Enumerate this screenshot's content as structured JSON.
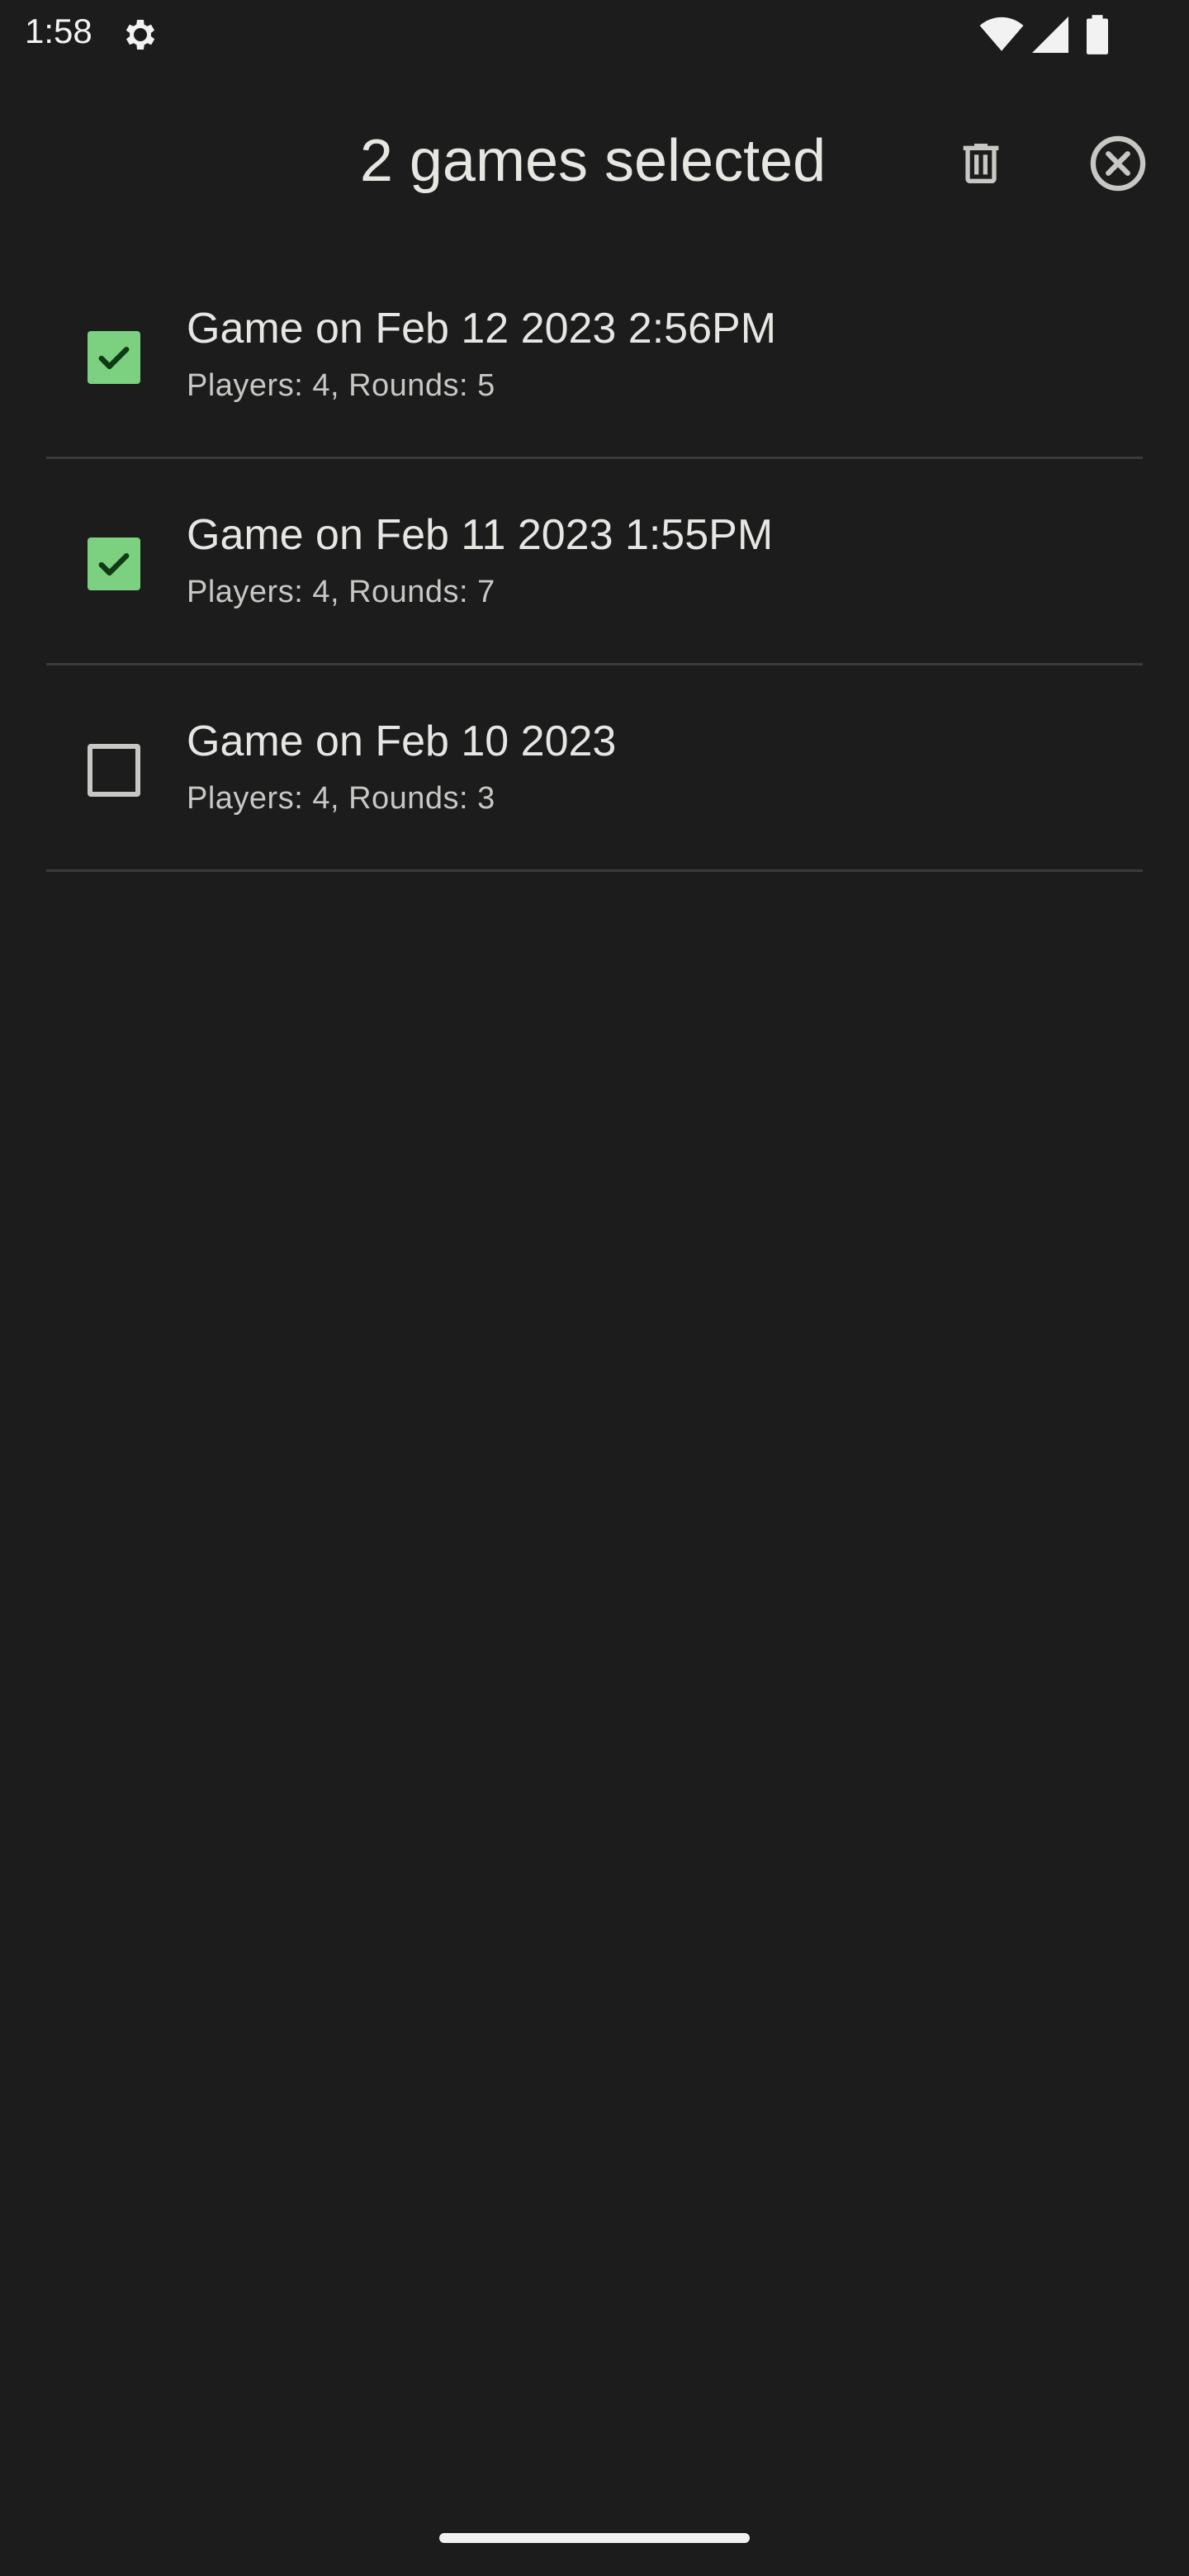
{
  "status_bar": {
    "time": "1:58",
    "icons": [
      "gear-icon",
      "wifi-icon",
      "signal-icon",
      "battery-icon"
    ]
  },
  "action_bar": {
    "title": "2 games selected",
    "delete_icon": "trash-icon",
    "close_icon": "close-circle-icon"
  },
  "games": [
    {
      "title": "Game on Feb 12 2023 2:56PM",
      "subtitle": "Players: 4, Rounds: 5",
      "checked": true
    },
    {
      "title": "Game on Feb 11 2023 1:55PM",
      "subtitle": "Players: 4, Rounds: 7",
      "checked": true
    },
    {
      "title": "Game on Feb 10 2023",
      "subtitle": "Players: 4, Rounds: 3",
      "checked": false
    }
  ],
  "colors": {
    "background": "#1b1c1b",
    "checkbox_checked": "#7bd17f",
    "text_primary": "#e6e6e3",
    "text_secondary": "#c6c8c4",
    "divider": "#3a3b39"
  }
}
